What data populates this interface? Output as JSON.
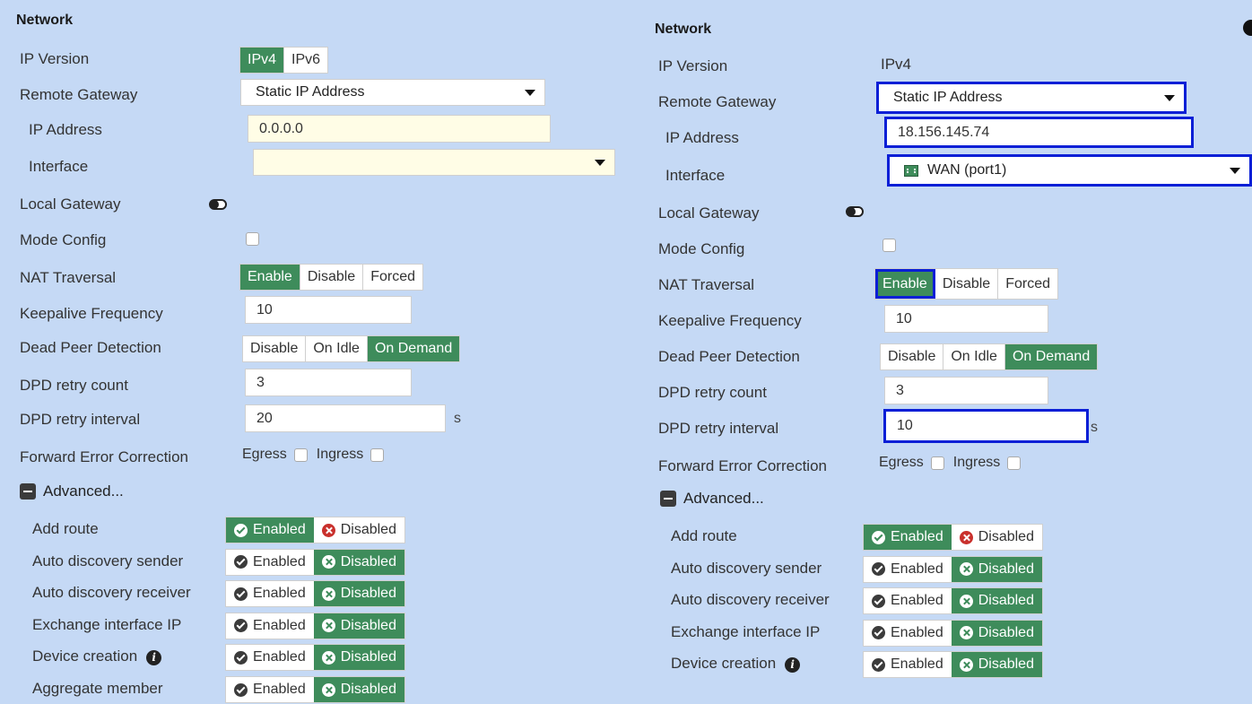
{
  "left": {
    "title": "Network",
    "ip_version_label": "IP Version",
    "ip_version_options": [
      "IPv4",
      "IPv6"
    ],
    "remote_gateway_label": "Remote Gateway",
    "remote_gateway_value": "Static IP Address",
    "ip_address_label": "IP Address",
    "ip_address_value": "0.0.0.0",
    "interface_label": "Interface",
    "interface_value": "",
    "local_gateway_label": "Local Gateway",
    "mode_config_label": "Mode Config",
    "nat_traversal_label": "NAT Traversal",
    "nat_options": [
      "Enable",
      "Disable",
      "Forced"
    ],
    "keepalive_label": "Keepalive Frequency",
    "keepalive_value": "10",
    "dpd_label": "Dead Peer Detection",
    "dpd_options": [
      "Disable",
      "On Idle",
      "On Demand"
    ],
    "dpd_retry_count_label": "DPD retry count",
    "dpd_retry_count_value": "3",
    "dpd_retry_interval_label": "DPD retry interval",
    "dpd_retry_interval_value": "20",
    "dpd_unit": "s",
    "fec_label": "Forward Error Correction",
    "fec_egress": "Egress",
    "fec_ingress": "Ingress",
    "advanced_label": "Advanced...",
    "enabled_label": "Enabled",
    "disabled_label": "Disabled",
    "adv_rows": [
      {
        "label": "Add route",
        "state": "enabled"
      },
      {
        "label": "Auto discovery sender",
        "state": "disabled"
      },
      {
        "label": "Auto discovery receiver",
        "state": "disabled"
      },
      {
        "label": "Exchange interface IP",
        "state": "disabled"
      },
      {
        "label": "Device creation",
        "state": "disabled",
        "info": true
      },
      {
        "label": "Aggregate member",
        "state": "disabled"
      }
    ]
  },
  "right": {
    "title": "Network",
    "ip_version_label": "IP Version",
    "ip_version_value": "IPv4",
    "remote_gateway_label": "Remote Gateway",
    "remote_gateway_value": "Static IP Address",
    "ip_address_label": "IP Address",
    "ip_address_value": "18.156.145.74",
    "interface_label": "Interface",
    "interface_value": "WAN (port1)",
    "local_gateway_label": "Local Gateway",
    "mode_config_label": "Mode Config",
    "nat_traversal_label": "NAT Traversal",
    "nat_options": [
      "Enable",
      "Disable",
      "Forced"
    ],
    "keepalive_label": "Keepalive Frequency",
    "keepalive_value": "10",
    "dpd_label": "Dead Peer Detection",
    "dpd_options": [
      "Disable",
      "On Idle",
      "On Demand"
    ],
    "dpd_retry_count_label": "DPD retry count",
    "dpd_retry_count_value": "3",
    "dpd_retry_interval_label": "DPD retry interval",
    "dpd_retry_interval_value": "10",
    "dpd_unit": "s",
    "fec_label": "Forward Error Correction",
    "fec_egress": "Egress",
    "fec_ingress": "Ingress",
    "advanced_label": "Advanced...",
    "enabled_label": "Enabled",
    "disabled_label": "Disabled",
    "adv_rows": [
      {
        "label": "Add route",
        "state": "enabled"
      },
      {
        "label": "Auto discovery sender",
        "state": "disabled"
      },
      {
        "label": "Auto discovery receiver",
        "state": "disabled"
      },
      {
        "label": "Exchange interface IP",
        "state": "disabled"
      },
      {
        "label": "Device creation",
        "state": "disabled",
        "info": true
      }
    ]
  },
  "colors": {
    "background": "#c5d9f5",
    "active_green": "#3e8c5b",
    "highlight_blue": "#0a1fd6",
    "input_yellow": "#fffde6",
    "disabled_red": "#c9302c"
  },
  "icons": [
    "check-circle-icon",
    "x-circle-icon",
    "info-icon",
    "collapse-minus-icon",
    "toggle-icon",
    "port-icon",
    "chevron-down-icon"
  ]
}
